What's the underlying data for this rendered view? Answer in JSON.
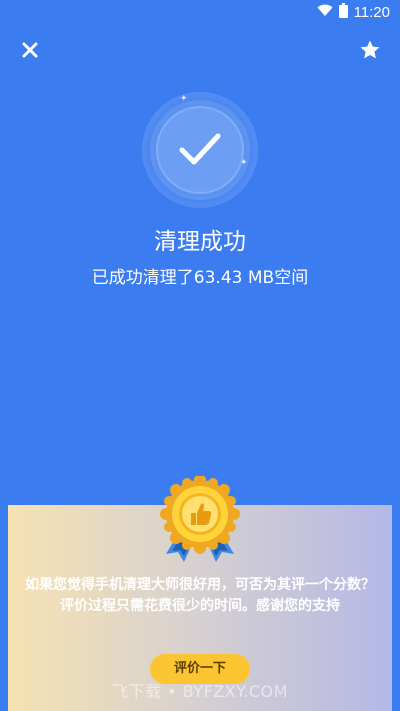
{
  "status_bar": {
    "time": "11:20",
    "icons": [
      "wifi-icon",
      "battery-icon"
    ]
  },
  "top_bar": {
    "close_icon": "close-icon",
    "favorite_icon": "star-icon"
  },
  "result": {
    "icon": "check-icon",
    "title": "清理成功",
    "subtitle": "已成功清理了63.43 MB空间"
  },
  "rating": {
    "badge_icon": "thumbs-up-badge-icon",
    "message": "如果您觉得手机清理大师很好用，可否为其评一个分数？评价过程只需花费很少的时间。感谢您的支持",
    "button_label": "评价一下"
  },
  "watermark": "飞下载 • BYFZXY.COM",
  "colors": {
    "background": "#3b7cf0",
    "check_circle": "#6c9ff3",
    "button": "#fbc531"
  }
}
